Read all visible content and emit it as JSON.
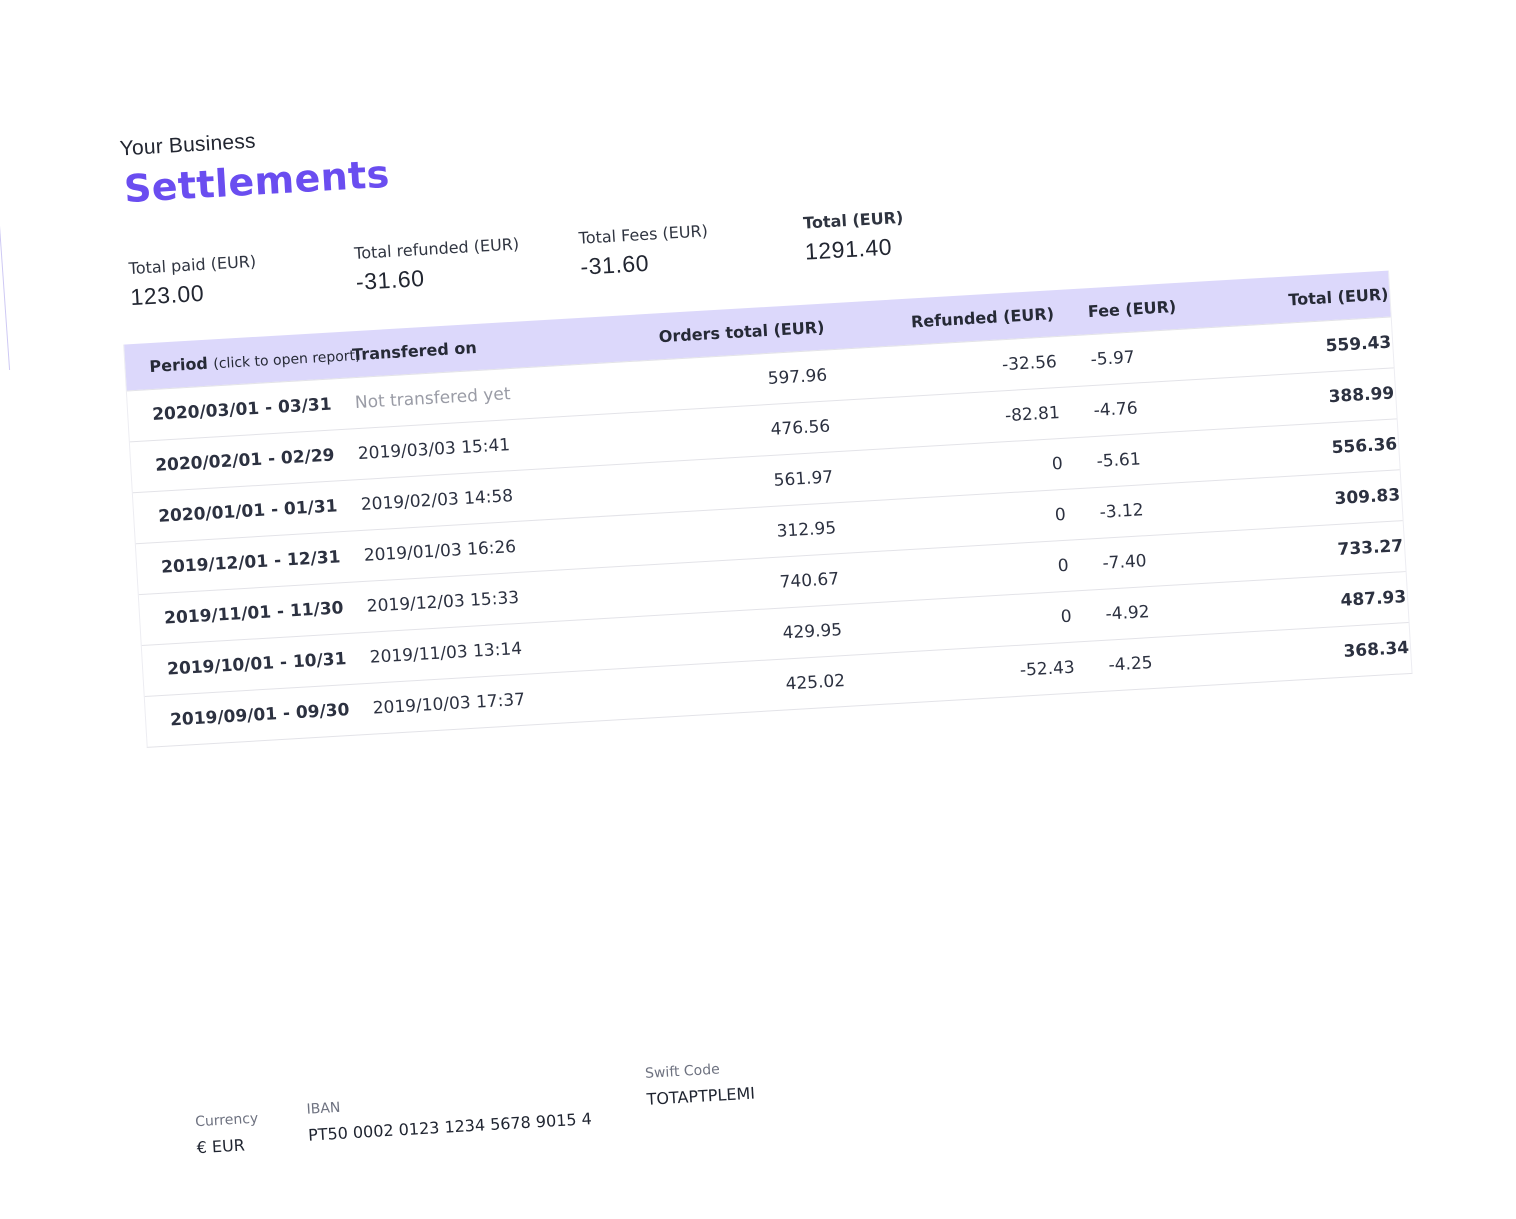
{
  "header": {
    "business": "Your Business",
    "title": "Settlements"
  },
  "summary": {
    "paid_label": "Total paid (EUR)",
    "paid_value": "123.00",
    "refunded_label": "Total refunded (EUR)",
    "refunded_value": "-31.60",
    "fees_label": "Total Fees (EUR)",
    "fees_value": "-31.60",
    "total_label": "Total (EUR)",
    "total_value": "1291.40"
  },
  "table": {
    "headers": {
      "period": "Period",
      "period_sub": "(click to open report)",
      "transferred": "Transfered on",
      "orders": "Orders total (EUR)",
      "refunded": "Refunded (EUR)",
      "fee": "Fee (EUR)",
      "total": "Total (EUR)"
    },
    "rows": [
      {
        "period": "2020/03/01 - 03/31",
        "transferred": "Not transfered yet",
        "orders": "597.96",
        "refunded": "-32.56",
        "fee": "-5.97",
        "total": "559.43"
      },
      {
        "period": "2020/02/01 - 02/29",
        "transferred": "2019/03/03 15:41",
        "orders": "476.56",
        "refunded": "-82.81",
        "fee": "-4.76",
        "total": "388.99"
      },
      {
        "period": "2020/01/01 - 01/31",
        "transferred": "2019/02/03 14:58",
        "orders": "561.97",
        "refunded": "0",
        "fee": "-5.61",
        "total": "556.36"
      },
      {
        "period": "2019/12/01 - 12/31",
        "transferred": "2019/01/03 16:26",
        "orders": "312.95",
        "refunded": "0",
        "fee": "-3.12",
        "total": "309.83"
      },
      {
        "period": "2019/11/01 - 11/30",
        "transferred": "2019/12/03 15:33",
        "orders": "740.67",
        "refunded": "0",
        "fee": "-7.40",
        "total": "733.27"
      },
      {
        "period": "2019/10/01 - 10/31",
        "transferred": "2019/11/03 13:14",
        "orders": "429.95",
        "refunded": "0",
        "fee": "-4.92",
        "total": "487.93"
      },
      {
        "period": "2019/09/01 - 09/30",
        "transferred": "2019/10/03 17:37",
        "orders": "425.02",
        "refunded": "-52.43",
        "fee": "-4.25",
        "total": "368.34"
      }
    ]
  },
  "footer": {
    "currency_label": "Currency",
    "currency_value": "€ EUR",
    "iban_label": "IBAN",
    "iban_value": "PT50 0002 0123 1234 5678 9015 4",
    "swift_label": "Swift Code",
    "swift_value": "TOTAPTPLEMI"
  },
  "colors": {
    "accent": "#6a4df0",
    "table_header_bg": "#dcd8fb",
    "muted_text": "#9a9ca6"
  }
}
